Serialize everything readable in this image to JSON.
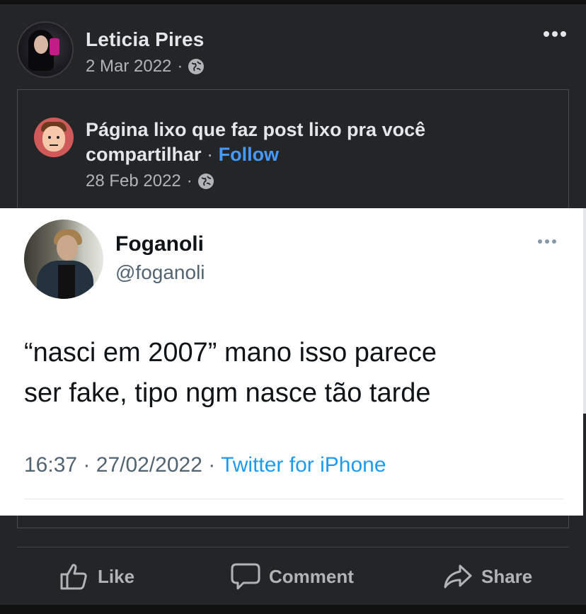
{
  "post": {
    "author": "Leticia Pires",
    "date": "2 Mar 2022",
    "separator": "·",
    "privacy_icon": "globe-icon",
    "more_icon": "more-options-icon"
  },
  "shared": {
    "page_name": "Página lixo que faz post lixo pra você compartilhar",
    "separator": "·",
    "follow_label": "Follow",
    "date": "28 Feb 2022",
    "date_separator": "·"
  },
  "tweet": {
    "name": "Foganoli",
    "handle": "@foganoli",
    "text_line1": "“nasci em 2007” mano isso parece",
    "text_line2": "ser fake, tipo ngm nasce tão tarde",
    "time": "16:37",
    "date": "27/02/2022",
    "separator": "·",
    "source": "Twitter for iPhone"
  },
  "actions": {
    "like_label": "Like",
    "comment_label": "Comment",
    "share_label": "Share"
  },
  "colors": {
    "background": "#242526",
    "text_primary": "#e4e6eb",
    "text_secondary": "#b0b3b8",
    "link": "#4599ff",
    "twitter_blue": "#1d9bf0"
  }
}
